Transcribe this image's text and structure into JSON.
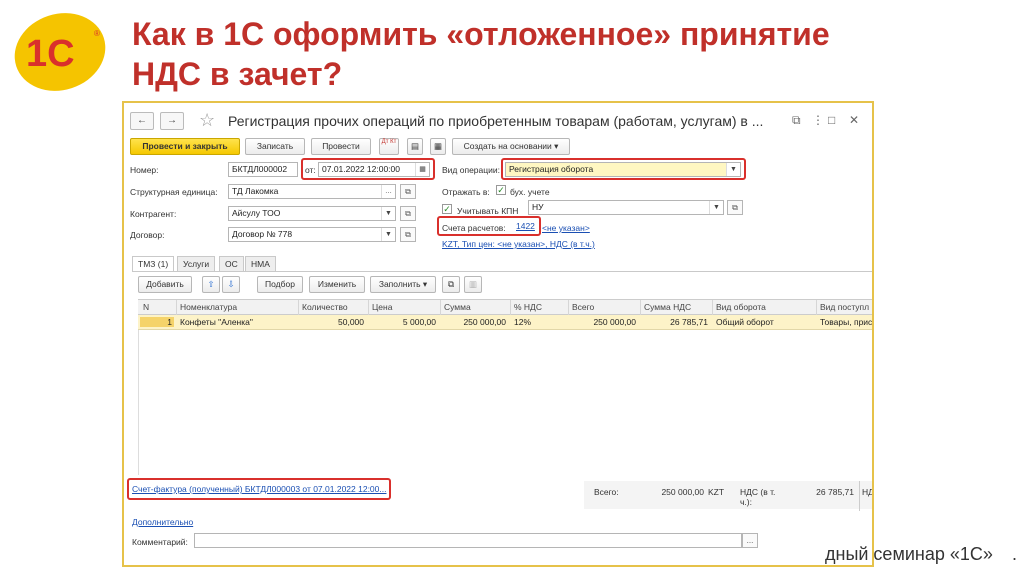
{
  "slide": {
    "title_line1": "Как в 1С оформить «отложенное» принятие",
    "title_line2": "НДС в зачет?",
    "footer": "дный семинар «1С»",
    "footer_dot": "."
  },
  "logo": {
    "text": "1С",
    "registered": "®",
    "colors": {
      "red": "#d9302c",
      "yellow": "#f5c400"
    }
  },
  "window": {
    "title": "Регистрация прочих операций по приобретенным товарам (работам, услугам) в ...",
    "nav": {
      "back": "←",
      "forward": "→"
    },
    "controls": {
      "link": "⧉",
      "more": "⋮",
      "maximize": "□",
      "close": "✕"
    }
  },
  "toolbar": {
    "post_close": "Провести и закрыть",
    "save": "Записать",
    "post": "Провести",
    "dt_kt": "Дт Кт",
    "create_based": "Создать на основании"
  },
  "form": {
    "number_label": "Номер:",
    "number_value": "БКТДЛ000002",
    "from_label": "от:",
    "date_value": "07.01.2022 12:00:00",
    "op_type_label": "Вид операции:",
    "op_type_value": "Регистрация оборота",
    "struct_label": "Структурная единица:",
    "struct_value": "ТД Лакомка",
    "reflect_label": "Отражать в:",
    "bu_label": "бух. учете",
    "contractor_label": "Контрагент:",
    "contractor_value": "Айсулу ТОО",
    "kpn_label": "Учитывать КПН",
    "kpn_value": "НУ",
    "contract_label": "Договор:",
    "contract_value": "Договор № 778",
    "accounts_label": "Счета расчетов:",
    "accounts_link": "1422",
    "accounts_link2": "<не указан>",
    "price_link": "KZT, Тип цен: <не указан>, НДС (в т.ч.)"
  },
  "tabs": [
    {
      "label": "ТМЗ (1)"
    },
    {
      "label": "Услуги"
    },
    {
      "label": "ОС"
    },
    {
      "label": "НМА"
    }
  ],
  "table_toolbar": {
    "add": "Добавить",
    "up": "⇧",
    "down": "⇩",
    "select": "Подбор",
    "change": "Изменить",
    "fill": "Заполнить"
  },
  "table": {
    "columns": [
      "N",
      "Номенклатура",
      "Количество",
      "Цена",
      "Сумма",
      "% НДС",
      "Всего",
      "Сумма НДС",
      "Вид оборота",
      "Вид поступл"
    ],
    "rows": [
      [
        "1",
        "Конфеты \"Аленка\"",
        "50,000",
        "5 000,00",
        "250 000,00",
        "12%",
        "250 000,00",
        "26 785,71",
        "Общий оборот",
        "Товары, прис"
      ]
    ]
  },
  "bottom": {
    "invoice_link": "Счет-фактура (полученный) БКТДЛ000003 от 07.01.2022 12:00...",
    "total_label": "Всего:",
    "total_value": "250 000,00",
    "currency": "KZT",
    "vat_label": "НДС (в т. ч.):",
    "vat_value": "26 785,71",
    "vat_tail": "НД",
    "more_link": "Дополнительно",
    "comment_label": "Комментарий:",
    "comment_value": "",
    "comment_btn": "..."
  }
}
